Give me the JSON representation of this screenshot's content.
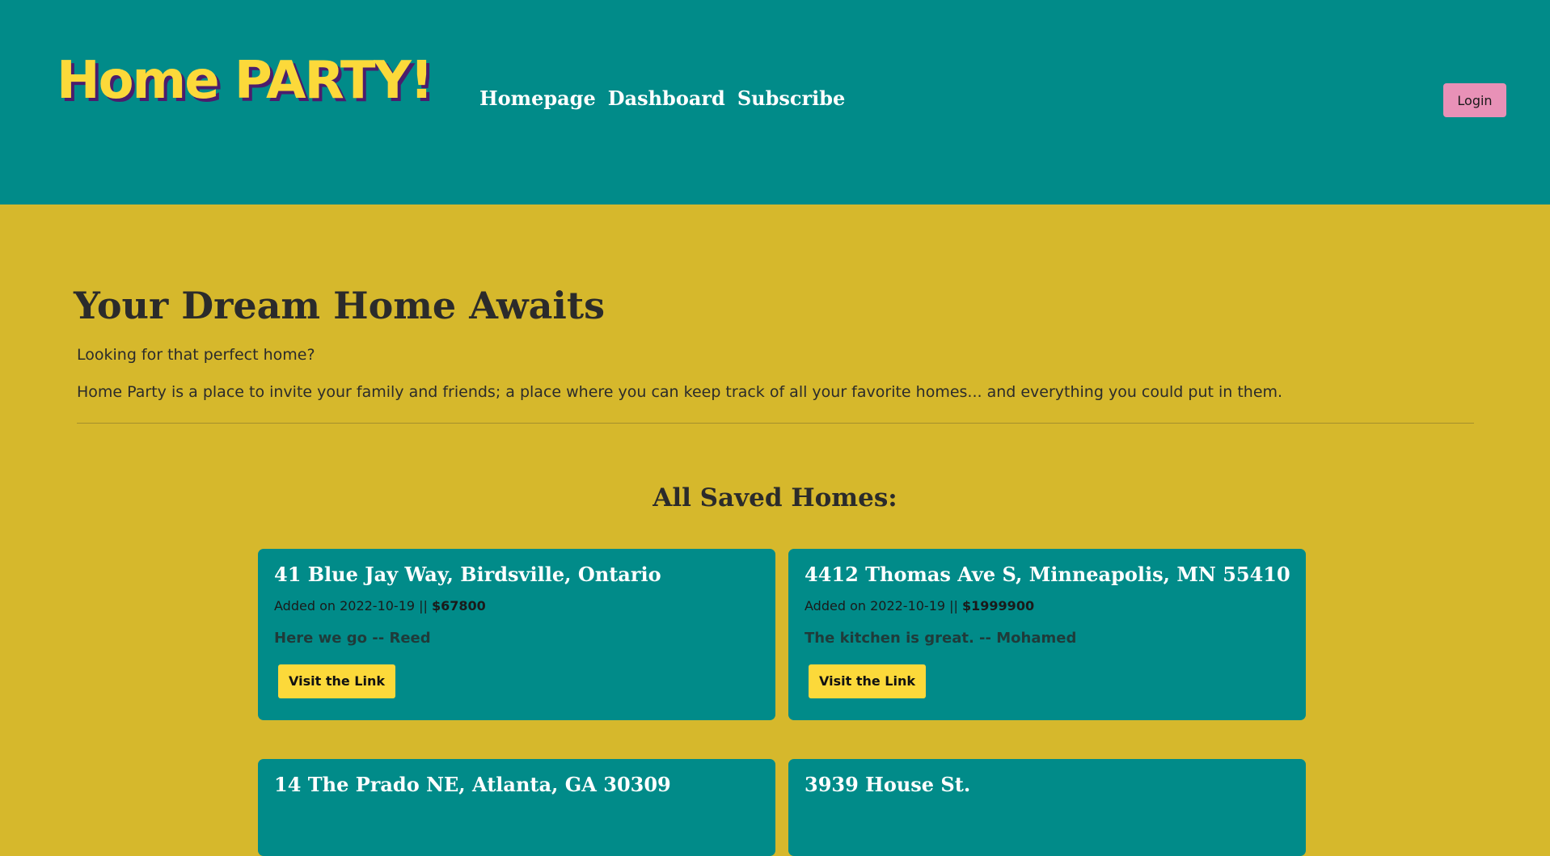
{
  "header": {
    "logo_text": "Home PARTY!",
    "nav": [
      {
        "label": "Homepage"
      },
      {
        "label": "Dashboard"
      },
      {
        "label": "Subscribe"
      }
    ],
    "login_label": "Login"
  },
  "hero": {
    "title": "Your Dream Home Awaits",
    "subtitle": "Looking for that perfect home?",
    "description": "Home Party is a place to invite your family and friends; a place where you can keep track of all your favorite homes... and everything you could put in them."
  },
  "saved": {
    "heading": "All Saved Homes:",
    "homes": [
      {
        "address": "41 Blue Jay Way, Birdsville, Ontario",
        "added_prefix": "Added on 2022-10-19 || ",
        "price": "$67800",
        "note": "Here we go -- Reed",
        "button_label": "Visit the Link"
      },
      {
        "address": "4412 Thomas Ave S, Minneapolis, MN 55410",
        "added_prefix": "Added on 2022-10-19 || ",
        "price": "$1999900",
        "note": "The kitchen is great. -- Mohamed",
        "button_label": "Visit the Link"
      },
      {
        "address": "14 The Prado NE, Atlanta, GA 30309"
      },
      {
        "address": "3939 House St."
      }
    ]
  },
  "colors": {
    "header_bg": "#018b89",
    "page_bg": "#d6b82c",
    "logo_yellow": "#fcd93a",
    "logo_shadow": "#4b1d6d",
    "login_pink": "#e891b7",
    "card_bg": "#018b89",
    "button_yellow": "#fcd93a"
  }
}
